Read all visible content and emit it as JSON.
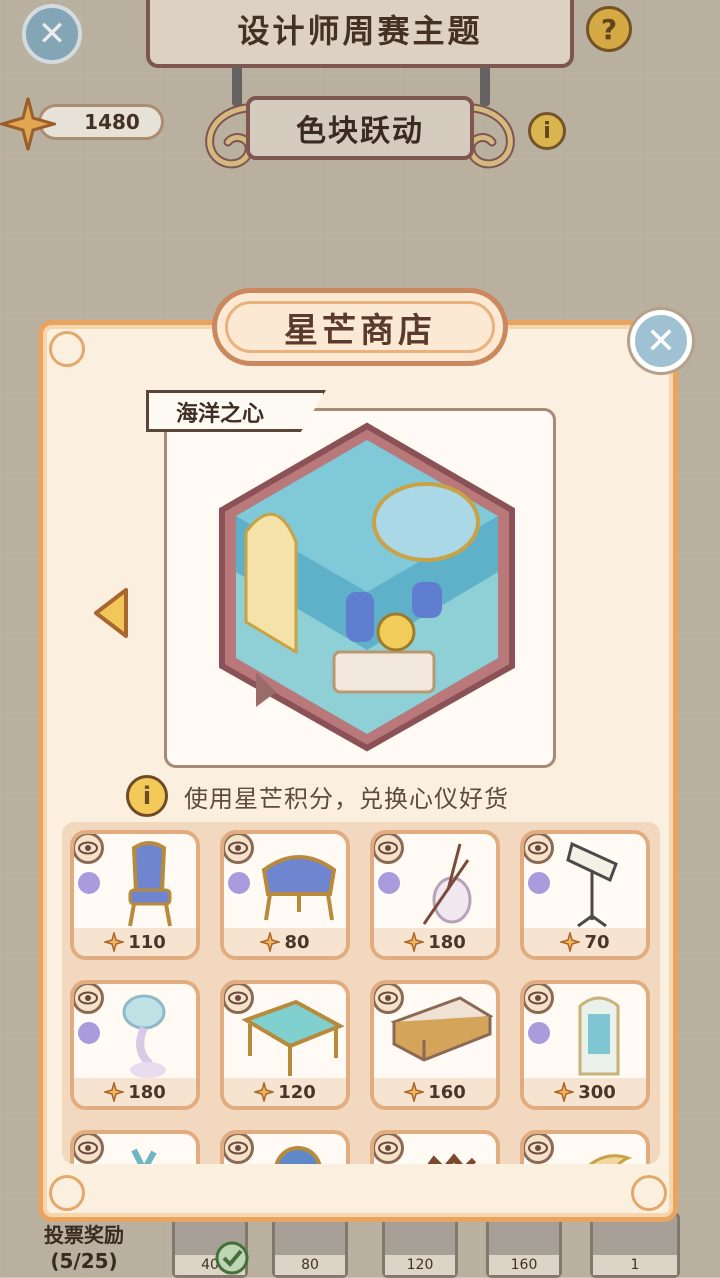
{
  "header": {
    "title": "设计师周赛主题",
    "theme": "色块跃动",
    "points": "1480"
  },
  "bottom": {
    "vote_line1": "",
    "vote_line2": "投票奖励",
    "vote_progress": "(5/25)",
    "rewards": [
      "40",
      "80",
      "120",
      "160",
      "1"
    ]
  },
  "shop": {
    "title": "星芒商店",
    "set_name": "海洋之心",
    "hint": "使用星芒积分，兑换心仪好货",
    "items": [
      {
        "price": "110",
        "icon": "chair-icon"
      },
      {
        "price": "80",
        "icon": "bench-icon"
      },
      {
        "price": "180",
        "icon": "cello-icon"
      },
      {
        "price": "70",
        "icon": "music-stand-icon"
      },
      {
        "price": "180",
        "icon": "shell-lamp-icon"
      },
      {
        "price": "120",
        "icon": "glass-table-icon"
      },
      {
        "price": "160",
        "icon": "desk-icon"
      },
      {
        "price": "300",
        "icon": "cabinet-icon"
      },
      {
        "price": "",
        "icon": "decor-icon"
      },
      {
        "price": "",
        "icon": "globe-icon"
      },
      {
        "price": "",
        "icon": "crown-icon"
      },
      {
        "price": "",
        "icon": "tail-icon"
      }
    ]
  },
  "colors": {
    "modal_border": "#e9a45f",
    "modal_bg": "#fbefdf",
    "accent_blue": "#9fc1d1",
    "gold": "#f3ca5a"
  }
}
